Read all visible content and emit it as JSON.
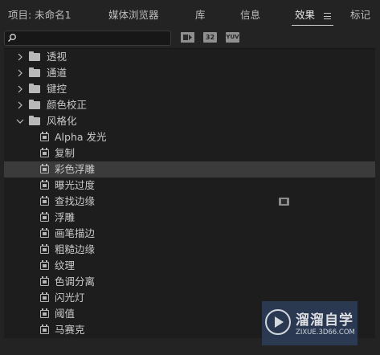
{
  "tabs": [
    {
      "label": "项目: 未命名1",
      "active": false
    },
    {
      "label": "媒体浏览器",
      "active": false
    },
    {
      "label": "库",
      "active": false
    },
    {
      "label": "信息",
      "active": false
    },
    {
      "label": "效果",
      "active": true
    },
    {
      "label": "标记",
      "active": false
    }
  ],
  "toolbar": {
    "search_value": "",
    "icons": [
      "accelerated-effects-icon",
      "32-bit-color-icon",
      "yuv-effects-icon"
    ],
    "badge_32": "32",
    "badge_yuv": "YUV"
  },
  "tree": [
    {
      "type": "folder",
      "label": "透视",
      "expanded": false
    },
    {
      "type": "folder",
      "label": "通道",
      "expanded": false
    },
    {
      "type": "folder",
      "label": "键控",
      "expanded": false
    },
    {
      "type": "folder",
      "label": "颜色校正",
      "expanded": false
    },
    {
      "type": "folder",
      "label": "风格化",
      "expanded": true
    },
    {
      "type": "effect",
      "label": "Alpha 发光"
    },
    {
      "type": "effect",
      "label": "复制"
    },
    {
      "type": "effect",
      "label": "彩色浮雕",
      "selected": true
    },
    {
      "type": "effect",
      "label": "曝光过度"
    },
    {
      "type": "effect",
      "label": "查找边缘",
      "accelerated": true
    },
    {
      "type": "effect",
      "label": "浮雕"
    },
    {
      "type": "effect",
      "label": "画笔描边"
    },
    {
      "type": "effect",
      "label": "粗糙边缘"
    },
    {
      "type": "effect",
      "label": "纹理"
    },
    {
      "type": "effect",
      "label": "色调分离"
    },
    {
      "type": "effect",
      "label": "闪光灯"
    },
    {
      "type": "effect",
      "label": "阈值"
    },
    {
      "type": "effect",
      "label": "马赛克"
    }
  ],
  "watermark": {
    "title": "溜溜自学",
    "url": "ZIXUE.3D66.COM"
  },
  "colors": {
    "background": "#232323",
    "panel": "#1d1d1d",
    "selected_row": "#3b3b3b",
    "watermark": "#2c3d57"
  }
}
